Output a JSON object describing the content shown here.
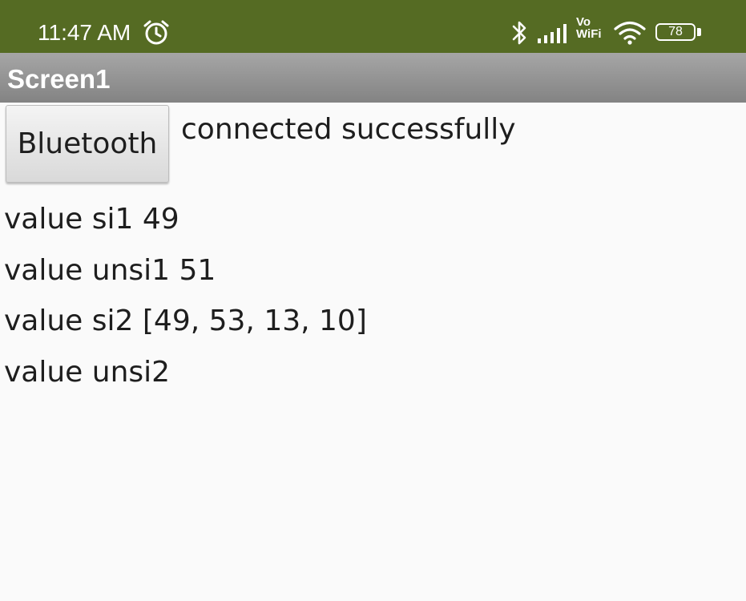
{
  "status_bar": {
    "time": "11:47 AM",
    "vo_label": "Vo",
    "wifi_label": "WiFi",
    "battery_level": "78",
    "background_color": "#556b23",
    "icons": [
      "alarm-icon",
      "bluetooth-icon",
      "signal-icon",
      "wifi-icon",
      "battery-icon"
    ]
  },
  "app_bar": {
    "title": "Screen1",
    "background_color": "#939393"
  },
  "main": {
    "bluetooth_button_label": "Bluetooth",
    "connection_status": "connected successfully",
    "values": [
      "value si1 49",
      "value unsi1 51",
      "value si2 [49, 53, 13, 10]",
      "value unsi2"
    ]
  }
}
